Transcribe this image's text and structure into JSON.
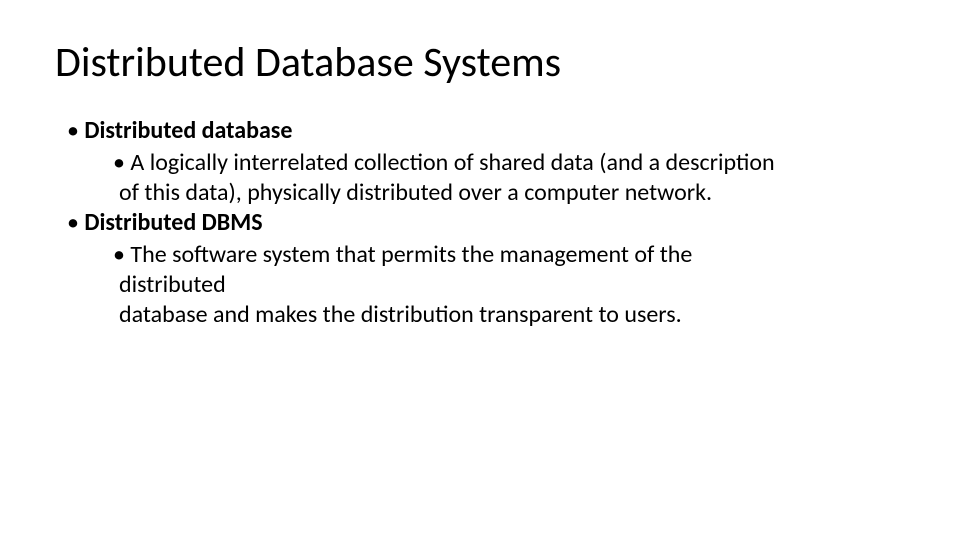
{
  "title": "Distributed Database Systems",
  "bullets": {
    "l1a_label": "Distributed database",
    "l2a_line1": "A logically interrelated collection of shared data (and a description",
    "l2a_line2": "of this data), physically distributed over a computer network.",
    "l1b_label": "Distributed DBMS",
    "l2b_line1": "The software system that permits the management of the",
    "l2b_line2": "distributed",
    "l2b_line3": "database and makes the distribution transparent to users."
  },
  "glyphs": {
    "dot": "•"
  }
}
